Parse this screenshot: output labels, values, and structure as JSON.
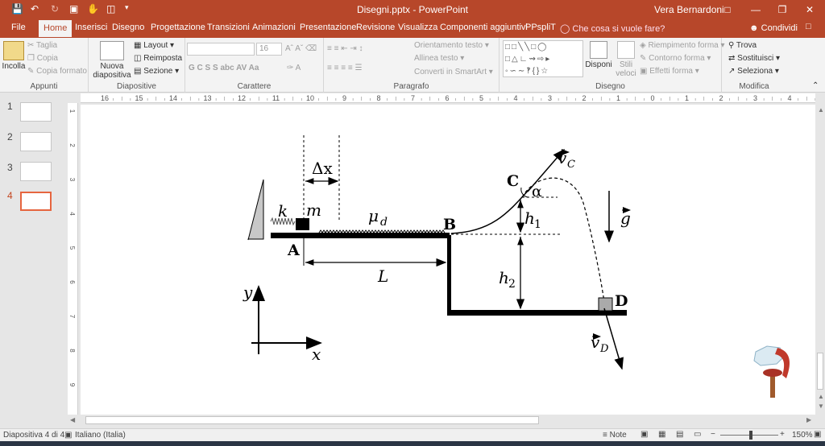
{
  "titlebar": {
    "title": "Disegni.pptx  -  PowerPoint",
    "user": "Vera Bernardoni"
  },
  "tabs": [
    "File",
    "Home",
    "Inserisci",
    "Disegno",
    "Progettazione",
    "Transizioni",
    "Animazioni",
    "Presentazione",
    "Revisione",
    "Visualizza",
    "Componenti aggiuntivi",
    "PPspliT"
  ],
  "active_tab": "Home",
  "tellme": "Che cosa si vuole fare?",
  "share": "Condividi",
  "ribbon": {
    "appunti": {
      "label": "Appunti",
      "incolla": "Incolla",
      "taglia": "Taglia",
      "copia": "Copia",
      "copia_formato": "Copia formato"
    },
    "diapositive": {
      "label": "Diapositive",
      "nuova": "Nuova diapositiva",
      "layout": "Layout",
      "reimposta": "Reimposta",
      "sezione": "Sezione"
    },
    "carattere": {
      "label": "Carattere",
      "font_size": "16",
      "styles": "G  C  S  S  abc  AV  Aa"
    },
    "paragrafo": {
      "label": "Paragrafo",
      "orientamento": "Orientamento testo",
      "allinea": "Allinea testo",
      "converti": "Converti in SmartArt"
    },
    "disegno": {
      "label": "Disegno",
      "disponi": "Disponi",
      "stili": "Stili veloci",
      "riempimento": "Riempimento forma",
      "contorno": "Contorno forma",
      "effetti": "Effetti forma"
    },
    "modifica": {
      "label": "Modifica",
      "trova": "Trova",
      "sostituisci": "Sostituisci",
      "seleziona": "Seleziona"
    }
  },
  "ruler_numbers": [
    "16",
    "15",
    "14",
    "13",
    "12",
    "11",
    "10",
    "9",
    "8",
    "7",
    "6",
    "5",
    "4",
    "3",
    "2",
    "1",
    "0",
    "1",
    "2",
    "3",
    "4"
  ],
  "vruler_numbers": [
    "1",
    "2",
    "3",
    "4",
    "5",
    "6",
    "7",
    "8",
    "9"
  ],
  "thumbnails": [
    "1",
    "2",
    "3",
    "4"
  ],
  "active_slide": "4",
  "diagram": {
    "dx": "Δx",
    "k": "k",
    "m": "m",
    "mu": "μ",
    "mu_sub": "d",
    "A": "A",
    "B": "B",
    "C": "C",
    "D": "D",
    "L": "L",
    "h1": "h",
    "h1_sub": "1",
    "h2": "h",
    "h2_sub": "2",
    "alpha": "α",
    "vC": "v",
    "vC_sub": "C",
    "vD": "v",
    "vD_sub": "D",
    "g": "g",
    "x": "x",
    "y": "y"
  },
  "status": {
    "slide_info": "Diapositiva 4 di 4",
    "language": "Italiano (Italia)",
    "note": "Note",
    "zoom": "150%"
  }
}
